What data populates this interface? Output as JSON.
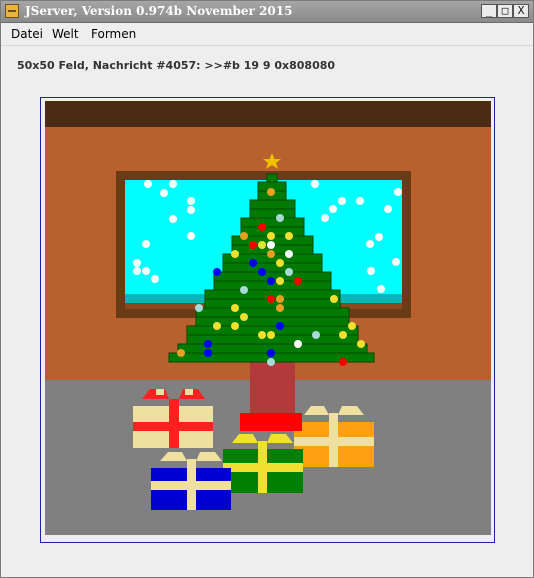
{
  "window": {
    "title": "JServer, Version 0.974b November 2015",
    "controls": {
      "minimize": "_",
      "maximize": "□",
      "close": "X"
    }
  },
  "menubar": {
    "items": [
      {
        "label": "Datei"
      },
      {
        "label": "Welt"
      },
      {
        "label": "Formen"
      }
    ]
  },
  "status": {
    "text": "50x50 Feld, Nachricht #4057: >>#b 19 9 0x808080"
  },
  "board": {
    "grid": "50x50",
    "colors": {
      "wall": "#b8602e",
      "floor": "#808080",
      "ceiling_beam": "#4a2b14",
      "window_frame": "#6b3a17",
      "window_glass": "#00ffff",
      "tree": "#007a00",
      "trunk": "#b33a3a",
      "star": "#f0c000"
    },
    "presents": [
      {
        "box": "#f0e0a0",
        "ribbon": "#ff2020"
      },
      {
        "box": "#0000d0",
        "ribbon": "#f0e0a0"
      },
      {
        "box": "#008000",
        "ribbon": "#f0e030"
      },
      {
        "box": "#ffa010",
        "ribbon": "#f0e0a0"
      }
    ]
  }
}
